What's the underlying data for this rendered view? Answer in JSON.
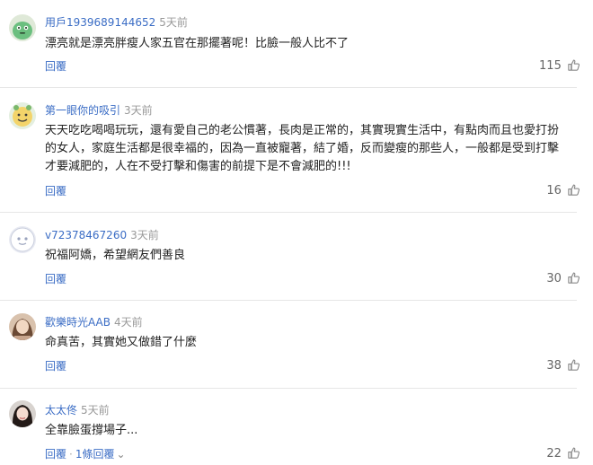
{
  "comments": [
    {
      "user": "用戶1939689144652",
      "time": "5天前",
      "text": "漂亮就是漂亮胖瘦人家五官在那擺著呢！比臉一般人比不了",
      "reply_label": "回覆",
      "likes": "115",
      "avatar": "green-cartoon-avatar"
    },
    {
      "user": "第一眼你的吸引",
      "time": "3天前",
      "text": "天天吃吃喝喝玩玩，還有愛自己的老公慣著，長肉是正常的，其實現實生活中，有點肉而且也愛打扮的女人，家庭生活都是很幸福的，因為一直被寵著，結了婚，反而變瘦的那些人，一般都是受到打擊才要減肥的，人在不受打擊和傷害的前提下是不會減肥的!!!",
      "reply_label": "回覆",
      "likes": "16",
      "avatar": "smiley-cartoon-avatar"
    },
    {
      "user": "v72378467260",
      "time": "3天前",
      "text": "祝福阿嬌，希望網友們善良",
      "reply_label": "回覆",
      "likes": "30",
      "avatar": "default-user-avatar"
    },
    {
      "user": "歡樂時光AAB",
      "time": "4天前",
      "text": "命真苦，其實她又做錯了什麼",
      "reply_label": "回覆",
      "likes": "38",
      "avatar": "photo-avatar"
    },
    {
      "user": "太太佟",
      "time": "5天前",
      "text": "全靠臉蛋撐場子...",
      "reply_label": "回覆",
      "replies_label": "1條回覆",
      "likes": "22",
      "avatar": "photo-avatar"
    }
  ],
  "colors": {
    "link": "#3b6dc5",
    "meta": "#999999",
    "text": "#222222",
    "separator": "#e6e6e6"
  }
}
